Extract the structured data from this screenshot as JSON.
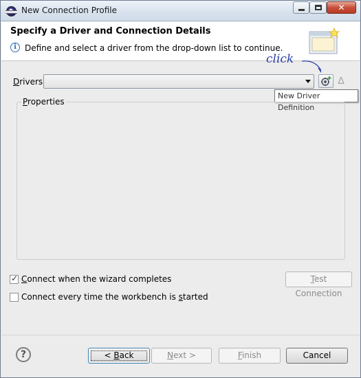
{
  "window": {
    "title": "New Connection Profile"
  },
  "header": {
    "title": "Specify a Driver and Connection Details",
    "description": "Define and select a driver from the drop-down list to continue."
  },
  "drivers": {
    "label_prefix": "",
    "label_mnemonic": "D",
    "label_rest": "rivers:",
    "selected": "",
    "new_tooltip": "New Driver Definition",
    "annotation": "click"
  },
  "properties": {
    "label_mnemonic": "P",
    "label_rest": "roperties"
  },
  "options": {
    "connect_on_complete": {
      "mnemonic": "C",
      "rest": "onnect when the wizard completes",
      "checked": true
    },
    "connect_every_time": {
      "before": "Connect every time the workbench is ",
      "mnemonic": "s",
      "after": "tarted",
      "checked": false
    }
  },
  "buttons": {
    "test_connection": {
      "mnemonic": "T",
      "rest": "est Connection"
    },
    "back": {
      "prefix": "< ",
      "mnemonic": "B",
      "rest": "ack"
    },
    "next": {
      "mnemonic": "N",
      "rest": "ext >"
    },
    "finish": {
      "mnemonic": "F",
      "rest": "inish"
    },
    "cancel": "Cancel"
  }
}
